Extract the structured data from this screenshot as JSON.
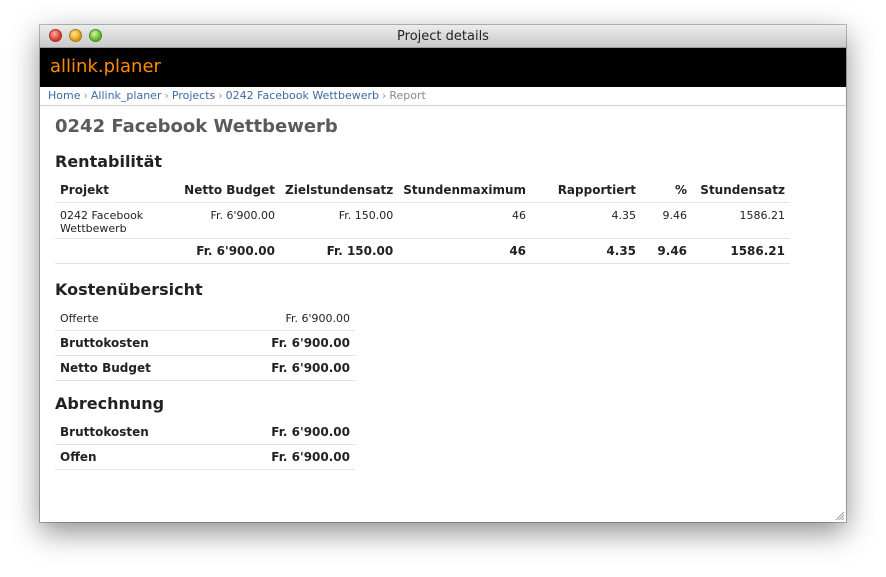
{
  "window": {
    "title": "Project details"
  },
  "app": {
    "brand": "allink.planer",
    "accent": "#ff8a00"
  },
  "breadcrumb": {
    "items": [
      "Home",
      "Allink_planer",
      "Projects",
      "0242 Facebook Wettbewerb"
    ],
    "current": "Report",
    "separator": "›"
  },
  "page": {
    "title": "0242 Facebook Wettbewerb"
  },
  "rentabilitaet": {
    "title": "Rentabilität",
    "headers": [
      "Projekt",
      "Netto Budget",
      "Zielstundensatz",
      "Stundenmaximum",
      "Rapportiert",
      "%",
      "Stundensatz"
    ],
    "row": {
      "projekt_line1": "0242 Facebook",
      "projekt_line2": "Wettbewerb",
      "netto_budget": "Fr. 6'900.00",
      "zielstundensatz": "Fr. 150.00",
      "stundenmaximum": "46",
      "rapportiert": "4.35",
      "prozent": "9.46",
      "stundensatz": "1586.21"
    },
    "total": {
      "netto_budget": "Fr. 6'900.00",
      "zielstundensatz": "Fr. 150.00",
      "stundenmaximum": "46",
      "rapportiert": "4.35",
      "prozent": "9.46",
      "stundensatz": "1586.21"
    }
  },
  "kostenuebersicht": {
    "title": "Kostenübersicht",
    "rows": [
      {
        "label": "Offerte",
        "value": "Fr. 6'900.00"
      },
      {
        "label": "Bruttokosten",
        "value": "Fr. 6'900.00"
      },
      {
        "label": "Netto Budget",
        "value": "Fr. 6'900.00"
      }
    ]
  },
  "abrechnung": {
    "title": "Abrechnung",
    "rows": [
      {
        "label": "Bruttokosten",
        "value": "Fr. 6'900.00"
      },
      {
        "label": "Offen",
        "value": "Fr. 6'900.00"
      }
    ]
  }
}
